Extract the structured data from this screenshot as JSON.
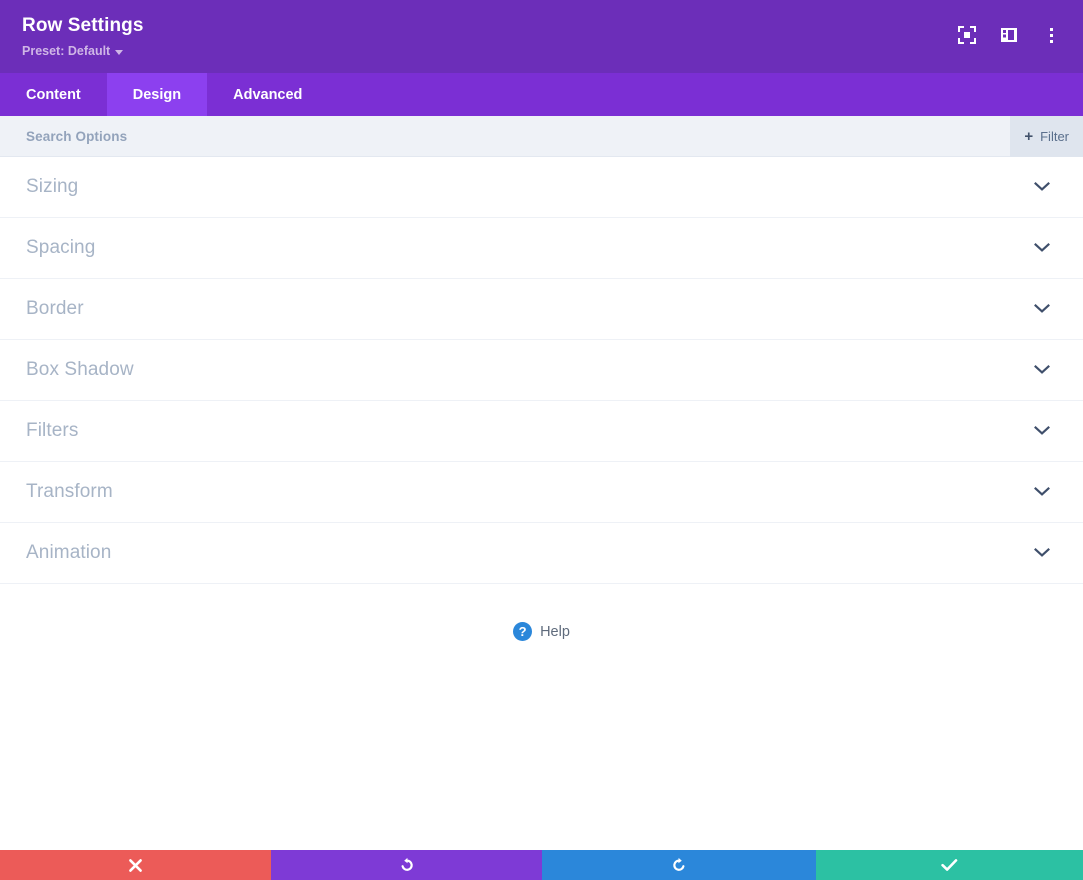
{
  "header": {
    "title": "Row Settings",
    "preset_label": "Preset: Default",
    "icons": {
      "expand": "expand-view-icon",
      "layout": "panel-layout-icon",
      "menu": "kebab-menu-icon"
    }
  },
  "tabs": [
    {
      "label": "Content",
      "active": false
    },
    {
      "label": "Design",
      "active": true
    },
    {
      "label": "Advanced",
      "active": false
    }
  ],
  "search": {
    "placeholder": "Search Options",
    "value": "",
    "filter_label": "Filter",
    "filter_plus": "+"
  },
  "sections": [
    {
      "label": "Sizing"
    },
    {
      "label": "Spacing"
    },
    {
      "label": "Border"
    },
    {
      "label": "Box Shadow"
    },
    {
      "label": "Filters"
    },
    {
      "label": "Transform"
    },
    {
      "label": "Animation"
    }
  ],
  "help": {
    "label": "Help",
    "glyph": "?"
  },
  "actions": [
    {
      "name": "close",
      "icon": "close-x-icon",
      "color": "#ec5b58"
    },
    {
      "name": "undo",
      "icon": "undo-arrow-icon",
      "color": "#7e3ad6"
    },
    {
      "name": "redo",
      "icon": "redo-arrow-icon",
      "color": "#2b87da"
    },
    {
      "name": "save",
      "icon": "checkmark-icon",
      "color": "#2cc1a3"
    }
  ],
  "colors": {
    "header_purple": "#6c2eb9",
    "tabbar_purple": "#7b2fd4",
    "active_tab_purple": "#8c40ef",
    "searchbar_bg": "#eff2f7",
    "filter_bg": "#dfe5ee",
    "section_text": "#a7b4c6",
    "chevron": "#3f4f6b",
    "help_blue": "#2b87da"
  }
}
